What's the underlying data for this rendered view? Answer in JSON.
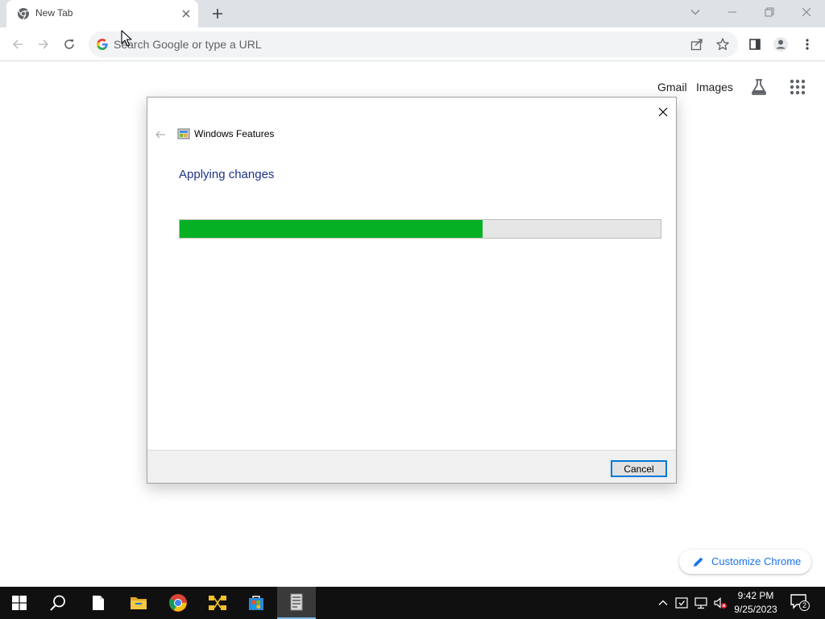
{
  "browser": {
    "tab": {
      "title": "New Tab"
    },
    "omnibox": {
      "placeholder": "Search Google or type a URL"
    }
  },
  "ntp": {
    "links": {
      "gmail": "Gmail",
      "images": "Images"
    },
    "customize_label": "Customize Chrome"
  },
  "dialog": {
    "window_title": "Windows Features",
    "heading": "Applying changes",
    "progress": 0.63,
    "cancel_label": "Cancel"
  },
  "taskbar": {
    "time": "9:42 PM",
    "date": "9/25/2023",
    "notification_count": "2"
  },
  "colors": {
    "progress_fill": "#06b025",
    "heading_blue": "#1e3287",
    "link_blue": "#1a73e8",
    "taskbar_bg": "#101010"
  },
  "icons": [
    "chrome-icon",
    "close-icon",
    "plus-icon",
    "chevron-down-icon",
    "minimize-icon",
    "restore-icon",
    "back-arrow-icon",
    "forward-arrow-icon",
    "reload-icon",
    "google-g-icon",
    "share-icon",
    "star-icon",
    "side-panel-icon",
    "profile-icon",
    "kebab-menu-icon",
    "labs-flask-icon",
    "apps-grid-icon",
    "pencil-icon",
    "windows-features-icon",
    "windows-start-icon",
    "search-icon",
    "file-icon",
    "file-explorer-icon",
    "network-icon",
    "store-icon",
    "tray-chevron-icon",
    "volume-muted-icon",
    "notification-icon"
  ]
}
